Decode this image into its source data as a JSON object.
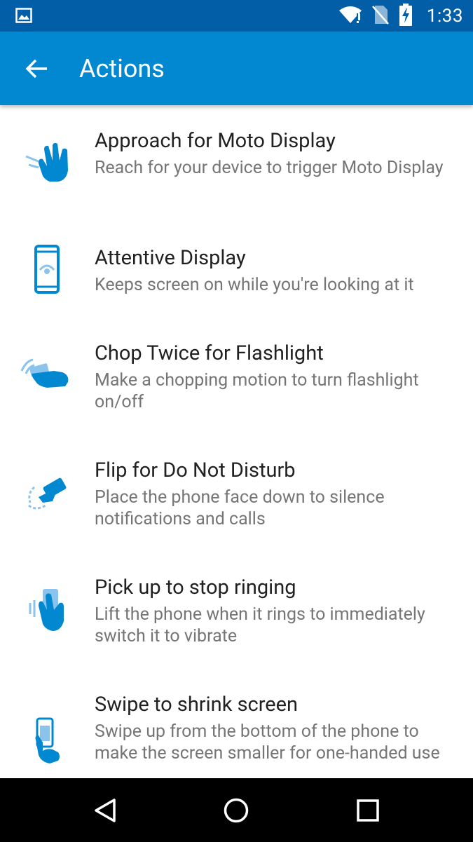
{
  "status_bar": {
    "time": "1:33",
    "icons": [
      "image-notification-icon",
      "wifi-icon",
      "no-sim-icon",
      "battery-charging-icon"
    ]
  },
  "app_bar": {
    "title": "Actions",
    "back_icon": "arrow-back-icon"
  },
  "items": [
    {
      "title": "Approach for Moto Display",
      "desc": "Reach for your device to trigger Moto Display",
      "icon": "approach-hand-icon"
    },
    {
      "title": "Attentive Display",
      "desc": "Keeps screen on while you're looking at it",
      "icon": "attentive-phone-icon"
    },
    {
      "title": "Chop Twice for Flashlight",
      "desc": "Make a chopping motion to turn flashlight on/off",
      "icon": "chop-hand-icon"
    },
    {
      "title": "Flip for Do Not Disturb",
      "desc": "Place the phone face down to silence notifications and calls",
      "icon": "flip-phone-icon"
    },
    {
      "title": "Pick up to stop ringing",
      "desc": "Lift the phone when it rings to immediately switch it to vibrate",
      "icon": "pickup-hand-icon"
    },
    {
      "title": "Swipe to shrink screen",
      "desc": "Swipe up from the bottom of the phone to make the screen smaller for one-handed use",
      "icon": "swipe-shrink-icon"
    }
  ],
  "nav_bar": {
    "buttons": [
      "back-triangle-icon",
      "home-circle-icon",
      "recents-square-icon"
    ]
  },
  "colors": {
    "status_bar": "#015ea7",
    "app_bar": "#0288d1",
    "icon_blue": "#0288d1",
    "title_text": "#212121",
    "desc_text": "#757575"
  }
}
